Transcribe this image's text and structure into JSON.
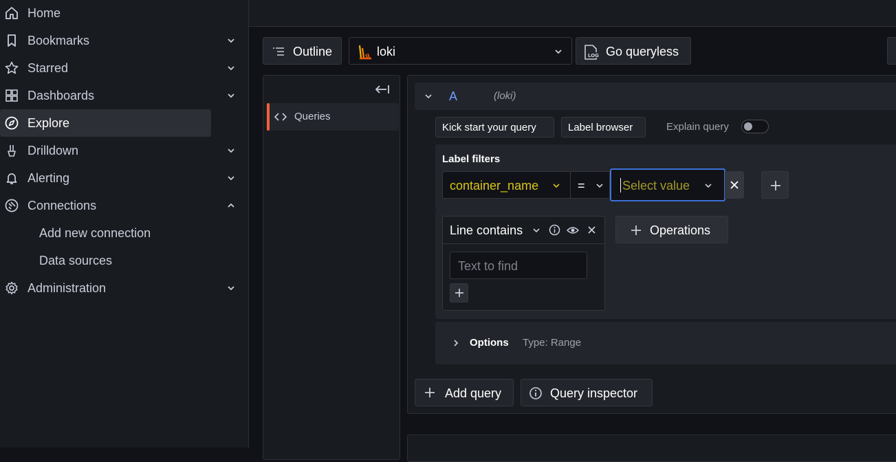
{
  "sidebar": {
    "items": [
      {
        "label": "Home",
        "icon": "home-icon",
        "has_chevron": false
      },
      {
        "label": "Bookmarks",
        "icon": "bookmark-icon",
        "has_chevron": true
      },
      {
        "label": "Starred",
        "icon": "star-icon",
        "has_chevron": true
      },
      {
        "label": "Dashboards",
        "icon": "dashboards-icon",
        "has_chevron": true
      },
      {
        "label": "Explore",
        "icon": "compass-icon",
        "has_chevron": false,
        "active": true
      },
      {
        "label": "Drilldown",
        "icon": "drilldown-icon",
        "has_chevron": true
      },
      {
        "label": "Alerting",
        "icon": "bell-icon",
        "has_chevron": true
      },
      {
        "label": "Connections",
        "icon": "connections-icon",
        "has_chevron": true,
        "expanded": true
      },
      {
        "label": "Add new connection",
        "sub": true
      },
      {
        "label": "Data sources",
        "sub": true
      },
      {
        "label": "Administration",
        "icon": "gear-icon",
        "has_chevron": true
      }
    ]
  },
  "toolbar": {
    "outline_label": "Outline",
    "datasource_label": "loki",
    "go_queryless_label": "Go queryless"
  },
  "outline_panel": {
    "queries_label": "Queries"
  },
  "query": {
    "ref_id": "A",
    "datasource": "(loki)",
    "kick_start_label": "Kick start your query",
    "label_browser_label": "Label browser",
    "explain_query_label": "Explain query",
    "label_filters_title": "Label filters",
    "label_name": "container_name",
    "operator": "=",
    "value_placeholder": "Select value",
    "line_contains_label": "Line contains",
    "text_to_find_placeholder": "Text to find",
    "operations_label": "Operations",
    "options_label": "Options",
    "options_type": "Type: Range",
    "add_query_label": "Add query",
    "query_inspector_label": "Query inspector"
  },
  "colors": {
    "accent_blue": "#6e9fff",
    "label_yellow": "#d8c51a",
    "active_indicator": "#f55f3e",
    "focus_border": "#3d71d9"
  }
}
